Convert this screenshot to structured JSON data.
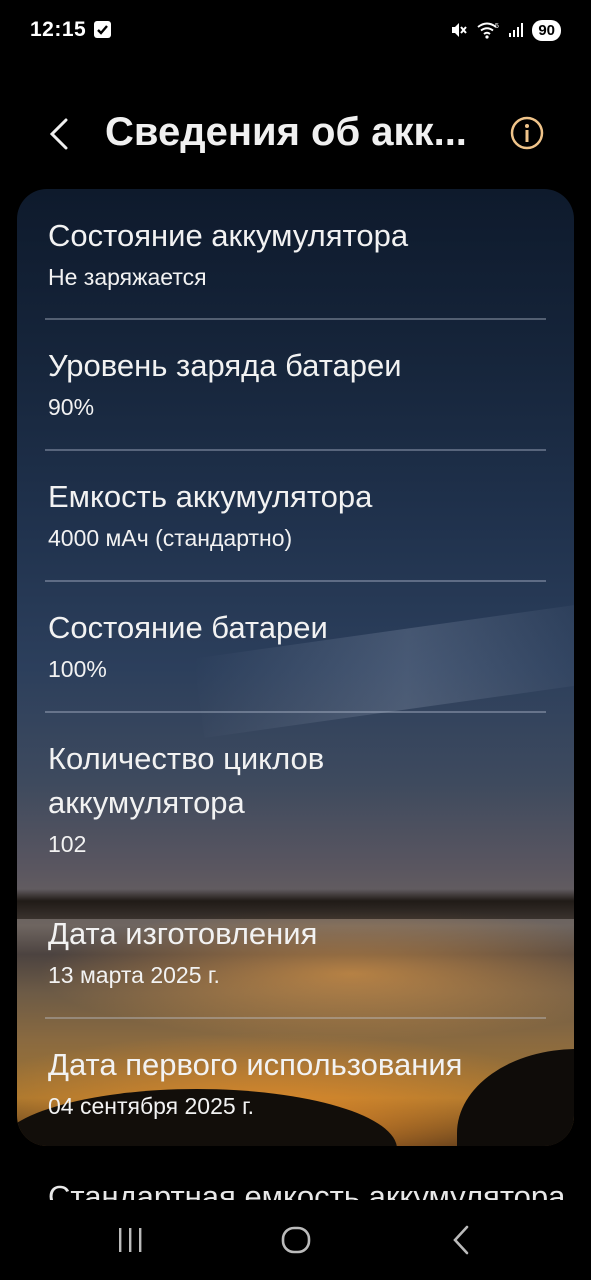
{
  "status_bar": {
    "time": "12:15",
    "battery": "90",
    "icons": [
      "check-icon",
      "mute-icon",
      "wifi-icon",
      "signal-icon"
    ]
  },
  "header": {
    "title": "Сведения об акк...",
    "back_icon": "chevron-left-icon",
    "info_icon": "info-icon",
    "info_color": "#f0c48a"
  },
  "items": [
    {
      "title": "Состояние аккумулятора",
      "value": "Не заряжается"
    },
    {
      "title": "Уровень заряда батареи",
      "value": "90%"
    },
    {
      "title": "Емкость аккумулятора",
      "value": "4000 мАч (стандартно)"
    },
    {
      "title": "Состояние батареи",
      "value": "100%"
    },
    {
      "title_line1": "Количество циклов",
      "title_line2": "аккумулятора",
      "value": "102"
    },
    {
      "title": "Дата изготовления",
      "value": "13 марта 2025 г."
    },
    {
      "title": "Дата первого использования",
      "value": "04 сентября 2025 г."
    }
  ],
  "partial_item": {
    "title": "Стандартная емкость аккумулятора"
  },
  "nav_bar": {
    "recents_icon": "recents-icon",
    "home_icon": "home-icon",
    "back_icon": "back-icon"
  }
}
